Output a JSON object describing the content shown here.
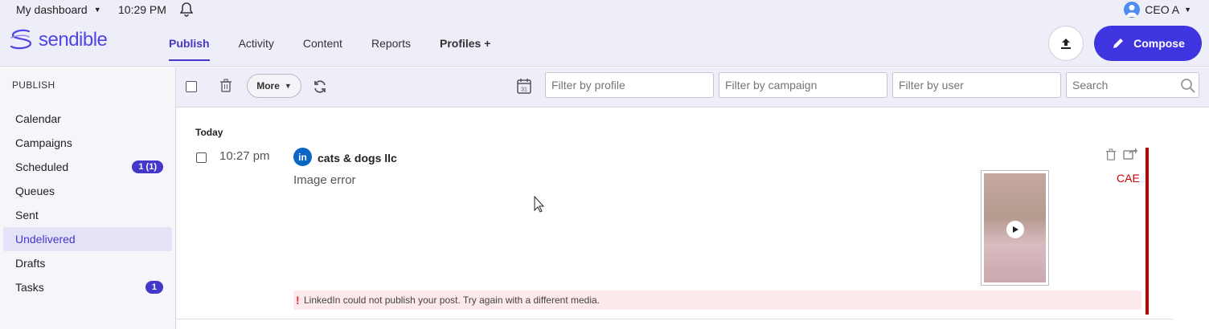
{
  "topbar": {
    "dashboard_label": "My dashboard",
    "time": "10:29 PM",
    "user_name": "CEO A"
  },
  "header": {
    "logo_text": "sendible",
    "nav": [
      {
        "label": "Publish",
        "active": true
      },
      {
        "label": "Activity",
        "active": false
      },
      {
        "label": "Content",
        "active": false
      },
      {
        "label": "Reports",
        "active": false
      },
      {
        "label": "Profiles +",
        "active": false
      }
    ],
    "compose_label": "Compose",
    "accent_color": "#3f35e0"
  },
  "sidebar": {
    "title": "PUBLISH",
    "items": [
      {
        "label": "Calendar",
        "badge": null,
        "active": false
      },
      {
        "label": "Campaigns",
        "badge": null,
        "active": false
      },
      {
        "label": "Scheduled",
        "badge": "1 (1)",
        "active": false
      },
      {
        "label": "Queues",
        "badge": null,
        "active": false
      },
      {
        "label": "Sent",
        "badge": null,
        "active": false
      },
      {
        "label": "Undelivered",
        "badge": null,
        "active": true
      },
      {
        "label": "Drafts",
        "badge": null,
        "active": false
      },
      {
        "label": "Tasks",
        "badge": "1",
        "active": false
      }
    ]
  },
  "toolbar": {
    "more_label": "More",
    "filter_profile_placeholder": "Filter by profile",
    "filter_campaign_placeholder": "Filter by campaign",
    "filter_user_placeholder": "Filter by user",
    "search_placeholder": "Search"
  },
  "content": {
    "day_label": "Today",
    "post": {
      "time": "10:27 pm",
      "profile_name": "cats & dogs llc",
      "network": "linkedin",
      "text": "Image error",
      "tag": "CAE",
      "error_message": "LinkedIn could not publish your post. Try again with a different media."
    }
  }
}
